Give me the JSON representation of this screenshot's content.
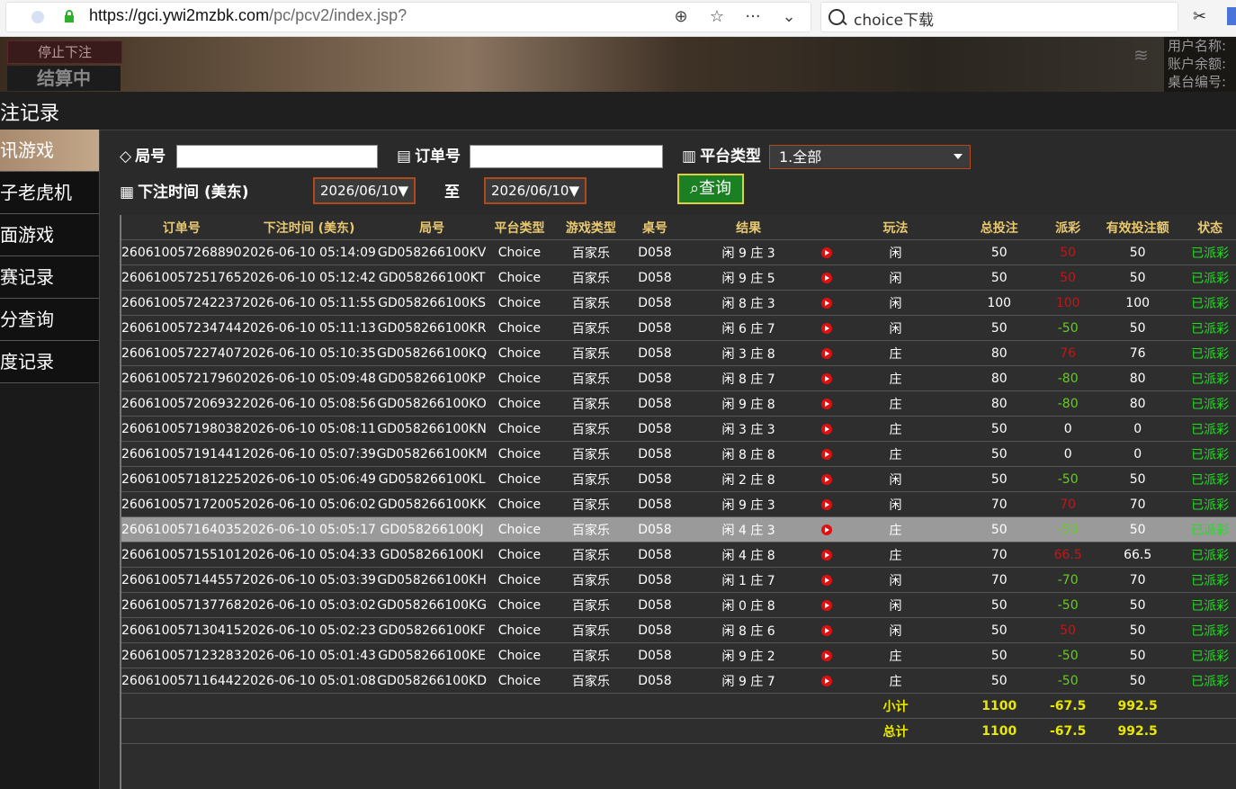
{
  "browser": {
    "url_host": "https://gci.ywi2mzbk.com",
    "url_path": "/pc/pcv2/index.jsp?",
    "search_text": "choice下载"
  },
  "header": {
    "stop_betting": "停止下注",
    "settling": "结算中",
    "user_info": [
      "用户名称:",
      "账户余额:",
      "桌台编号:"
    ]
  },
  "page_title": "注记录",
  "sidebar": {
    "items": [
      {
        "label": "讯游戏",
        "active": true
      },
      {
        "label": "子老虎机"
      },
      {
        "label": "面游戏"
      },
      {
        "label": "赛记录"
      },
      {
        "label": "分查询"
      },
      {
        "label": "度记录"
      }
    ]
  },
  "filters": {
    "round_label": "局号",
    "order_label": "订单号",
    "platform_label": "平台类型",
    "platform_value": "1.全部",
    "time_label": "下注时间 (美东)",
    "date_from": "2026/06/10▼",
    "to_label": "至",
    "date_to": "2026/06/10▼",
    "query_label": "查询"
  },
  "table": {
    "headers": [
      "订单号",
      "下注时间 (美东)",
      "局号",
      "平台类型",
      "游戏类型",
      "桌号",
      "结果",
      "",
      "玩法",
      "总投注",
      "派彩",
      "有效投注额",
      "状态"
    ],
    "rows": [
      {
        "order": "260610057268890",
        "time": "2026-06-10 05:14:09",
        "round": "GD058266100KV",
        "platform": "Choice",
        "game": "百家乐",
        "table": "D058",
        "result": "闲 9 庄 3",
        "play": "闲",
        "bet": "50",
        "payout": "50",
        "payout_color": "red",
        "valid": "50",
        "status": "已派彩"
      },
      {
        "order": "260610057251765",
        "time": "2026-06-10 05:12:42",
        "round": "GD058266100KT",
        "platform": "Choice",
        "game": "百家乐",
        "table": "D058",
        "result": "闲 9 庄 5",
        "play": "闲",
        "bet": "50",
        "payout": "50",
        "payout_color": "red",
        "valid": "50",
        "status": "已派彩"
      },
      {
        "order": "260610057242237",
        "time": "2026-06-10 05:11:55",
        "round": "GD058266100KS",
        "platform": "Choice",
        "game": "百家乐",
        "table": "D058",
        "result": "闲 8 庄 3",
        "play": "闲",
        "bet": "100",
        "payout": "100",
        "payout_color": "red",
        "valid": "100",
        "status": "已派彩"
      },
      {
        "order": "260610057234744",
        "time": "2026-06-10 05:11:13",
        "round": "GD058266100KR",
        "platform": "Choice",
        "game": "百家乐",
        "table": "D058",
        "result": "闲 6 庄 7",
        "play": "闲",
        "bet": "50",
        "payout": "-50",
        "payout_color": "green",
        "valid": "50",
        "status": "已派彩"
      },
      {
        "order": "260610057227407",
        "time": "2026-06-10 05:10:35",
        "round": "GD058266100KQ",
        "platform": "Choice",
        "game": "百家乐",
        "table": "D058",
        "result": "闲 3 庄 8",
        "play": "庄",
        "bet": "80",
        "payout": "76",
        "payout_color": "red",
        "valid": "76",
        "status": "已派彩"
      },
      {
        "order": "260610057217960",
        "time": "2026-06-10 05:09:48",
        "round": "GD058266100KP",
        "platform": "Choice",
        "game": "百家乐",
        "table": "D058",
        "result": "闲 8 庄 7",
        "play": "庄",
        "bet": "80",
        "payout": "-80",
        "payout_color": "green",
        "valid": "80",
        "status": "已派彩"
      },
      {
        "order": "260610057206932",
        "time": "2026-06-10 05:08:56",
        "round": "GD058266100KO",
        "platform": "Choice",
        "game": "百家乐",
        "table": "D058",
        "result": "闲 9 庄 8",
        "play": "庄",
        "bet": "80",
        "payout": "-80",
        "payout_color": "green",
        "valid": "80",
        "status": "已派彩"
      },
      {
        "order": "260610057198038",
        "time": "2026-06-10 05:08:11",
        "round": "GD058266100KN",
        "platform": "Choice",
        "game": "百家乐",
        "table": "D058",
        "result": "闲 3 庄 3",
        "play": "庄",
        "bet": "50",
        "payout": "0",
        "payout_color": "white",
        "valid": "0",
        "status": "已派彩"
      },
      {
        "order": "260610057191441",
        "time": "2026-06-10 05:07:39",
        "round": "GD058266100KM",
        "platform": "Choice",
        "game": "百家乐",
        "table": "D058",
        "result": "闲 8 庄 8",
        "play": "庄",
        "bet": "50",
        "payout": "0",
        "payout_color": "white",
        "valid": "0",
        "status": "已派彩"
      },
      {
        "order": "260610057181225",
        "time": "2026-06-10 05:06:49",
        "round": "GD058266100KL",
        "platform": "Choice",
        "game": "百家乐",
        "table": "D058",
        "result": "闲 2 庄 8",
        "play": "闲",
        "bet": "50",
        "payout": "-50",
        "payout_color": "green",
        "valid": "50",
        "status": "已派彩"
      },
      {
        "order": "260610057172005",
        "time": "2026-06-10 05:06:02",
        "round": "GD058266100KK",
        "platform": "Choice",
        "game": "百家乐",
        "table": "D058",
        "result": "闲 9 庄 3",
        "play": "闲",
        "bet": "70",
        "payout": "70",
        "payout_color": "red",
        "valid": "70",
        "status": "已派彩"
      },
      {
        "order": "260610057164035",
        "time": "2026-06-10 05:05:17",
        "round": "GD058266100KJ",
        "platform": "Choice",
        "game": "百家乐",
        "table": "D058",
        "result": "闲 4 庄 3",
        "play": "庄",
        "bet": "50",
        "payout": "-50",
        "payout_color": "green",
        "valid": "50",
        "status": "已派彩",
        "selected": true
      },
      {
        "order": "260610057155101",
        "time": "2026-06-10 05:04:33",
        "round": "GD058266100KI",
        "platform": "Choice",
        "game": "百家乐",
        "table": "D058",
        "result": "闲 4 庄 8",
        "play": "庄",
        "bet": "70",
        "payout": "66.5",
        "payout_color": "red",
        "valid": "66.5",
        "status": "已派彩"
      },
      {
        "order": "260610057144557",
        "time": "2026-06-10 05:03:39",
        "round": "GD058266100KH",
        "platform": "Choice",
        "game": "百家乐",
        "table": "D058",
        "result": "闲 1 庄 7",
        "play": "闲",
        "bet": "70",
        "payout": "-70",
        "payout_color": "green",
        "valid": "70",
        "status": "已派彩"
      },
      {
        "order": "260610057137768",
        "time": "2026-06-10 05:03:02",
        "round": "GD058266100KG",
        "platform": "Choice",
        "game": "百家乐",
        "table": "D058",
        "result": "闲 0 庄 8",
        "play": "闲",
        "bet": "50",
        "payout": "-50",
        "payout_color": "green",
        "valid": "50",
        "status": "已派彩"
      },
      {
        "order": "260610057130415",
        "time": "2026-06-10 05:02:23",
        "round": "GD058266100KF",
        "platform": "Choice",
        "game": "百家乐",
        "table": "D058",
        "result": "闲 8 庄 6",
        "play": "闲",
        "bet": "50",
        "payout": "50",
        "payout_color": "red",
        "valid": "50",
        "status": "已派彩"
      },
      {
        "order": "260610057123283",
        "time": "2026-06-10 05:01:43",
        "round": "GD058266100KE",
        "platform": "Choice",
        "game": "百家乐",
        "table": "D058",
        "result": "闲 9 庄 2",
        "play": "庄",
        "bet": "50",
        "payout": "-50",
        "payout_color": "green",
        "valid": "50",
        "status": "已派彩"
      },
      {
        "order": "260610057116442",
        "time": "2026-06-10 05:01:08",
        "round": "GD058266100KD",
        "platform": "Choice",
        "game": "百家乐",
        "table": "D058",
        "result": "闲 9 庄 7",
        "play": "庄",
        "bet": "50",
        "payout": "-50",
        "payout_color": "green",
        "valid": "50",
        "status": "已派彩"
      }
    ],
    "subtotal": {
      "label": "小计",
      "bet": "1100",
      "payout": "-67.5",
      "valid": "992.5"
    },
    "total": {
      "label": "总计",
      "bet": "1100",
      "payout": "-67.5",
      "valid": "992.5"
    }
  },
  "colors": {
    "red": "#c01818",
    "green": "#66cc22",
    "status_green": "#22dd22",
    "header_gold": "#e8c870",
    "sum_yellow": "#e8e800"
  }
}
